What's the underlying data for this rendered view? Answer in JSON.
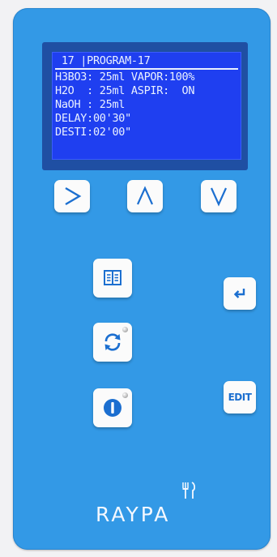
{
  "display": {
    "header": " 17 |PROGRAM-17",
    "lines": [
      "H3BO3: 25ml VAPOR:100%",
      "H2O  : 25ml ASPIR:  ON",
      "NaOH : 25ml",
      "DELAY:00'30\"",
      "DESTI:02'00\""
    ]
  },
  "buttons": {
    "edit_label": "EDIT"
  },
  "brand": {
    "name": "RAYPA"
  },
  "colors": {
    "panel": "#3399e6",
    "lcd": "#1f3ff0",
    "icon_blue": "#1c6fd0"
  },
  "icons": [
    "right-arrow-icon",
    "up-arrow-icon",
    "down-arrow-icon",
    "book-icon",
    "enter-icon",
    "refresh-icon",
    "power-icon",
    "utensils-icon"
  ]
}
